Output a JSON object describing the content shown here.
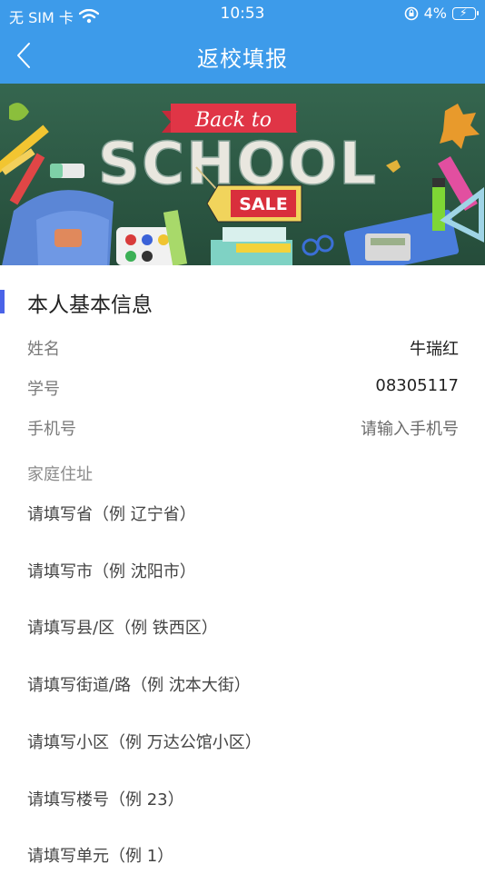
{
  "status_bar": {
    "carrier": "无 SIM 卡",
    "time": "10:53",
    "battery": "4%"
  },
  "nav": {
    "title": "返校填报"
  },
  "banner": {
    "top_text": "Back to",
    "main_text": "SCHOOL",
    "tag_text": "SALE"
  },
  "section": {
    "title": "本人基本信息"
  },
  "fields": {
    "name_label": "姓名",
    "name_value": "牛瑞红",
    "id_label": "学号",
    "id_value": "08305117",
    "phone_label": "手机号",
    "phone_placeholder": "请输入手机号",
    "address_label": "家庭住址"
  },
  "address_inputs": [
    "请填写省（例 辽宁省）",
    "请填写市（例 沈阳市）",
    "请填写县/区（例 铁西区）",
    "请填写街道/路（例 沈本大街）",
    "请填写小区（例 万达公馆小区）",
    "请填写楼号（例 23）",
    "请填写单元（例 1）"
  ],
  "colors": {
    "header_blue": "#3d9bea",
    "section_bar": "#4a63e8"
  }
}
